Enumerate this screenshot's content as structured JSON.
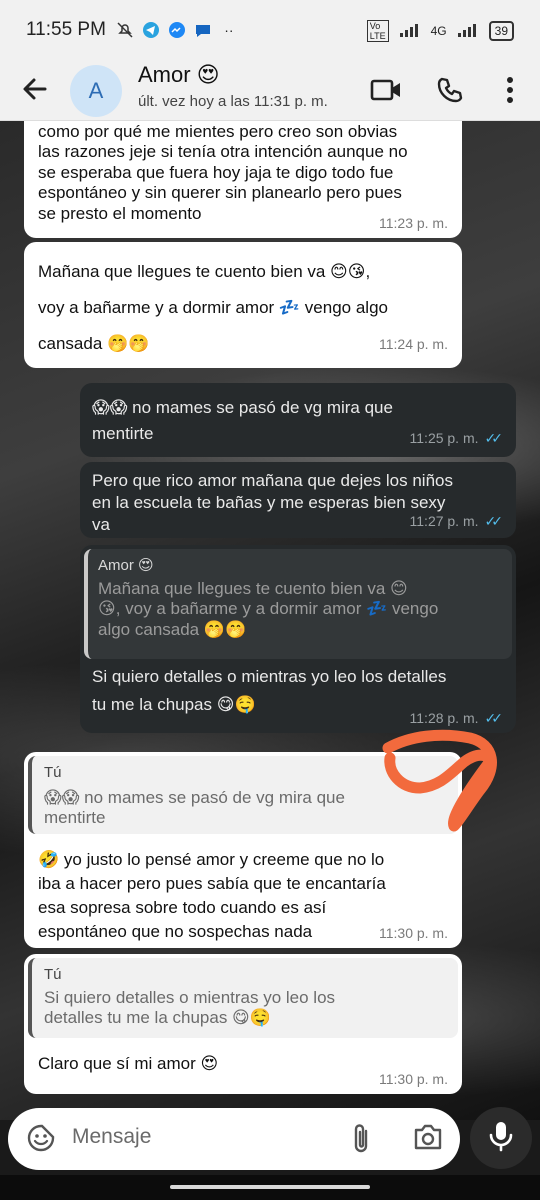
{
  "status_bar": {
    "time": "11:55 PM",
    "battery": "39",
    "network": "4G"
  },
  "header": {
    "contact_name": "Amor 😍",
    "avatar_letter": "A",
    "last_seen": "últ. vez hoy a las 11:31 p. m."
  },
  "messages": [
    {
      "direction": "incoming",
      "lines": [
        "como por qué me mientes pero creo son obvias",
        "las razones jeje si tenía otra intención aunque no",
        "se esperaba que fuera hoy jaja te digo todo fue",
        "espontáneo y sin querer sin planearlo pero pues",
        "se presto el momento"
      ],
      "time": "11:23 p. m."
    },
    {
      "direction": "incoming",
      "lines": [
        "Mañana que llegues te cuento bien va 😊😘,",
        "voy a bañarme y a dormir amor 💤 vengo algo",
        "cansada 🤭🤭"
      ],
      "time": "11:24 p. m."
    },
    {
      "direction": "outgoing",
      "lines": [
        "😱😱 no mames se pasó de vg mira que",
        "mentirte"
      ],
      "time": "11:25 p. m.",
      "read": true
    },
    {
      "direction": "outgoing",
      "lines": [
        "Pero que rico amor mañana que dejes los niños",
        "en la escuela te bañas y me esperas bien sexy",
        "va"
      ],
      "time": "11:27 p. m.",
      "read": true
    },
    {
      "direction": "outgoing",
      "quote_author": "Amor 😍",
      "quote_lines": [
        "Mañana que llegues te cuento bien va 😊",
        "😘, voy a bañarme y a dormir amor 💤 vengo",
        "algo cansada 🤭🤭"
      ],
      "lines": [
        "Si quiero detalles o mientras yo leo los detalles",
        "tu me la chupas 😋🤤"
      ],
      "time": "11:28 p. m.",
      "read": true
    },
    {
      "direction": "incoming",
      "quote_author": "Tú",
      "quote_lines": [
        "😱😱 no mames se pasó de vg mira que",
        "mentirte"
      ],
      "lines": [
        "🤣 yo justo lo pensé amor y creeme que no lo",
        "iba a hacer pero pues sabía que te encantaría",
        "esa sopresa sobre todo cuando es así",
        "espontáneo que no sospechas nada"
      ],
      "time": "11:30 p. m."
    },
    {
      "direction": "incoming",
      "quote_author": "Tú",
      "quote_lines": [
        "Si quiero detalles o mientras yo leo los",
        "detalles tu me la chupas 😋🤤"
      ],
      "lines": [
        "Claro que sí mi amor 😍"
      ],
      "time": "11:30 p. m."
    }
  ],
  "composer": {
    "placeholder": "Mensaje"
  },
  "icons": [
    "back-arrow-icon",
    "video-call-icon",
    "phone-icon",
    "more-vertical-icon",
    "emoji-sticker-icon",
    "attach-icon",
    "camera-icon",
    "mic-icon"
  ],
  "colors": {
    "incoming_bubble": "#ffffff",
    "outgoing_bubble": "#262a2c",
    "read_ticks": "#53bdeb",
    "scribble": "#f26a3d"
  }
}
